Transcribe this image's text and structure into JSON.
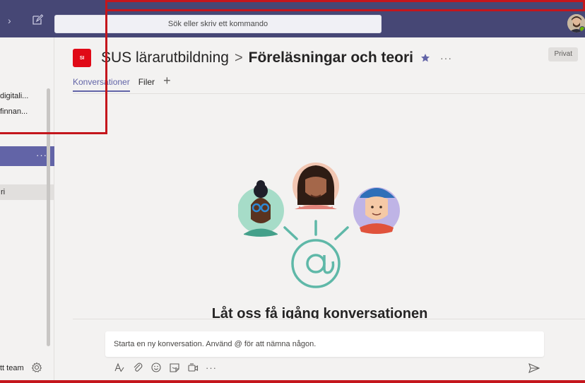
{
  "topbar": {
    "search_placeholder": "Sök eller skriv ett kommando"
  },
  "leftpanel": {
    "channels_partial": [
      "digitali...",
      "finnan..."
    ],
    "selected_team_more": "···",
    "active_channel_partial": "ri",
    "footer_partial": "tt team"
  },
  "header": {
    "team_badge": "SI",
    "team_name": "SUS lärarutbildning",
    "separator": ">",
    "channel_name": "Föreläsningar och teori",
    "more": "···",
    "privacy": "Privat"
  },
  "tabs": [
    {
      "label": "Konversationer",
      "active": true
    },
    {
      "label": "Filer",
      "active": false
    }
  ],
  "tabs_add": "+",
  "empty_state": {
    "title": "Låt oss få igång konversationen"
  },
  "compose": {
    "placeholder": "Starta en ny konversation. Använd @ för att nämna någon.",
    "more": "···"
  },
  "colors": {
    "topbar": "#464775",
    "accent": "#6264a7",
    "badge_red": "#e00a17",
    "frame_red": "#c4161c",
    "teal": "#5fb8a8"
  }
}
